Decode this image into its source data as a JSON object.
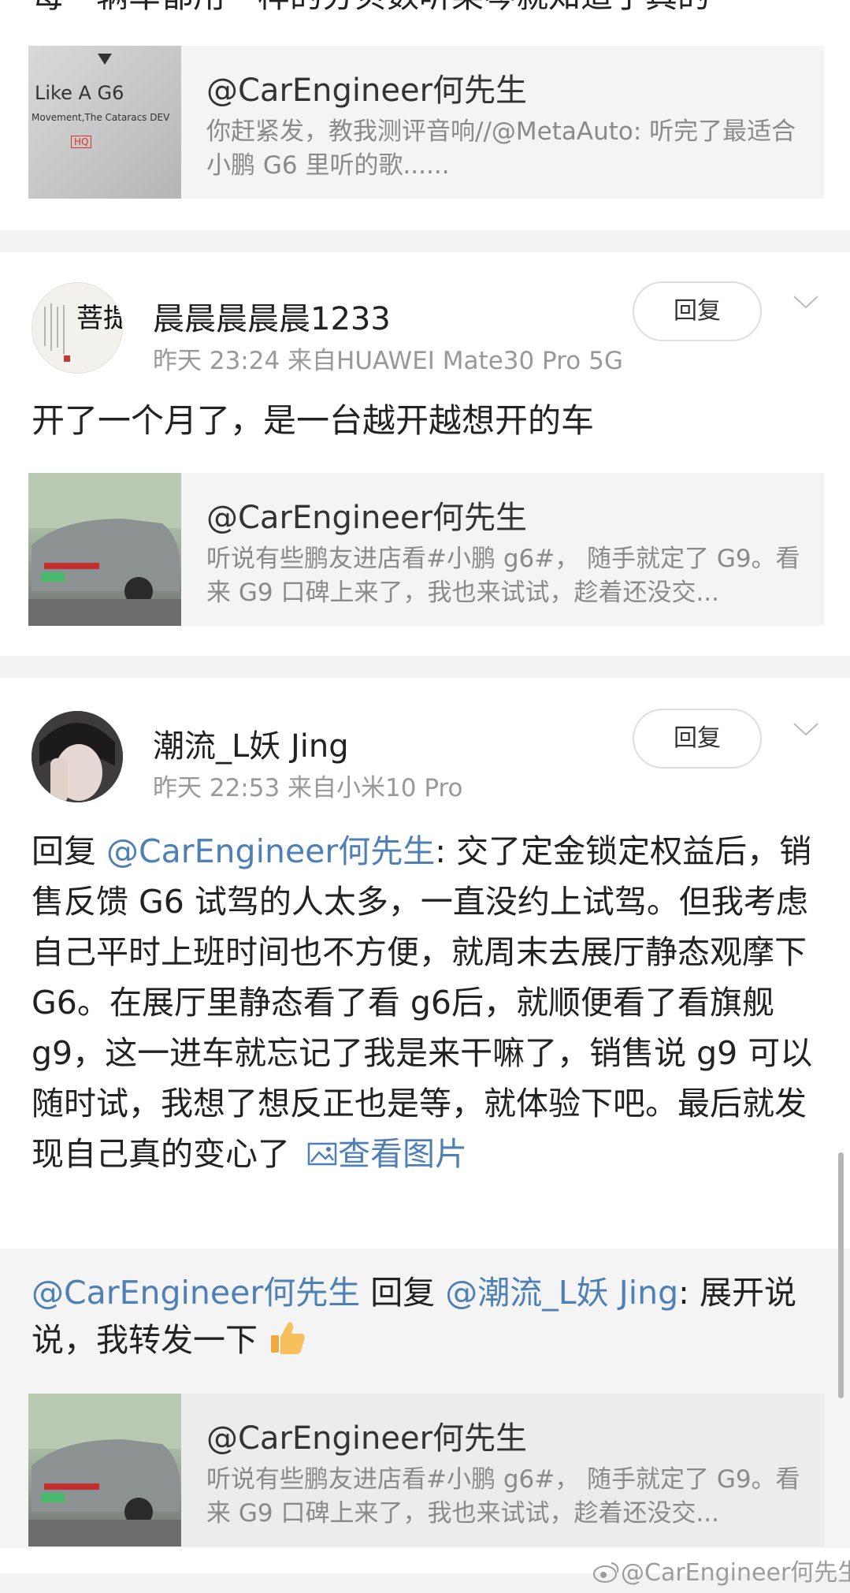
{
  "top_cut_text": "每一辆车都用一样的分贝数听某琴就知道了真的",
  "comments": [
    {
      "quote": {
        "author": "@CarEngineer何先生",
        "text": "你赶紧发，教我测评音响//@MetaAuto: 听完了最适合小鹏 G6 里听的歌......",
        "thumb_title": "Like A G6",
        "thumb_sub": "Movement,The Cataracs DEV",
        "thumb_badge": "HQ"
      }
    },
    {
      "username": "晨晨晨晨晨1233",
      "meta": "昨天 23:24  来自HUAWEI Mate30 Pro 5G",
      "avatar_chars": "菩提",
      "reply_label": "回复",
      "text": "开了一个月了，是一台越开越想开的车",
      "quote": {
        "author": "@CarEngineer何先生",
        "text": "听说有些鹏友进店看#小鹏 g6#， 随手就定了 G9。看来 G9 口碑上来了，我也来试试，趁着还没交..."
      }
    },
    {
      "username": "潮流_L妖 Jing",
      "meta": "昨天 22:53  来自小米10 Pro",
      "reply_label": "回复",
      "text_prefix": "回复 ",
      "text_mention": "@CarEngineer何先生",
      "text_body": ": 交了定金锁定权益后，销售反馈 G6 试驾的人太多，一直没约上试驾。但我考虑自己平时上班时间也不方便，就周末去展厅静态观摩下 G6。在展厅里静态看了看 g6后，就顺便看了看旗舰 g9，这一进车就忘记了我是来干嘛了，销售说 g9 可以随时试，我想了想反正也是等，就体验下吧。最后就发现自己真的变心了",
      "view_image_label": "查看图片",
      "sub_reply": {
        "author": "@CarEngineer何先生",
        "reply_word": " 回复 ",
        "target": "@潮流_L妖 Jing",
        "text": ": 展开说说，我转发一下"
      },
      "quote": {
        "author": "@CarEngineer何先生",
        "text": "听说有些鹏友进店看#小鹏 g6#， 随手就定了 G9。看来 G9 口碑上来了，我也来试试，趁着还没交..."
      }
    }
  ],
  "watermark": "@CarEngineer何先生",
  "colors": {
    "link": "#4e7fb5",
    "gap": "#f2f2f2",
    "card": "#f4f4f4",
    "meta": "#999999"
  }
}
